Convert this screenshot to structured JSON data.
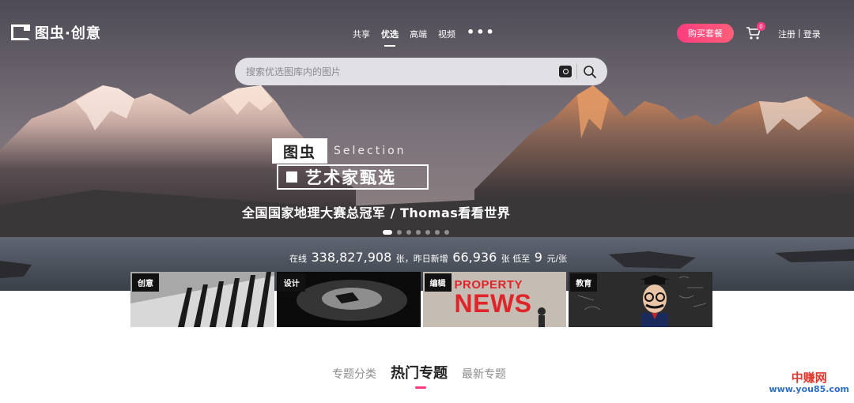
{
  "header": {
    "logo_text": "图虫·创意",
    "nav": [
      "共享",
      "优选",
      "高端",
      "视频"
    ],
    "nav_more": "•••",
    "buy_button": "购买套餐",
    "cart_count": "0",
    "register": "注册",
    "auth_sep": "|",
    "login": "登录"
  },
  "search": {
    "placeholder": "搜索优选图库内的图片"
  },
  "banner": {
    "brand": "图虫",
    "selection": "Selection",
    "title": "艺术家甄选",
    "subtitle": "全国国家地理大赛总冠军 / Thomas看看世界",
    "slides": 7,
    "active_slide": 1
  },
  "stats": {
    "online_label": "在线",
    "online_count": "338,827,908",
    "online_unit": "张，昨日新增",
    "new_count": "66,936",
    "new_unit": "张 低至",
    "price": "9",
    "price_unit": "元/张"
  },
  "categories": [
    "创意",
    "设计",
    "编辑",
    "教育"
  ],
  "news_tile": {
    "line1": "PROPERTY",
    "line2": "NEWS"
  },
  "topic_tabs": [
    "专题分类",
    "热门专题",
    "最新专题"
  ],
  "watermark": {
    "line1": "中赚网",
    "line2": "www.you85.com"
  },
  "colors": {
    "accent": "#ff3d7f",
    "watermark_red": "#e8342a",
    "watermark_blue": "#2c6ec9"
  }
}
